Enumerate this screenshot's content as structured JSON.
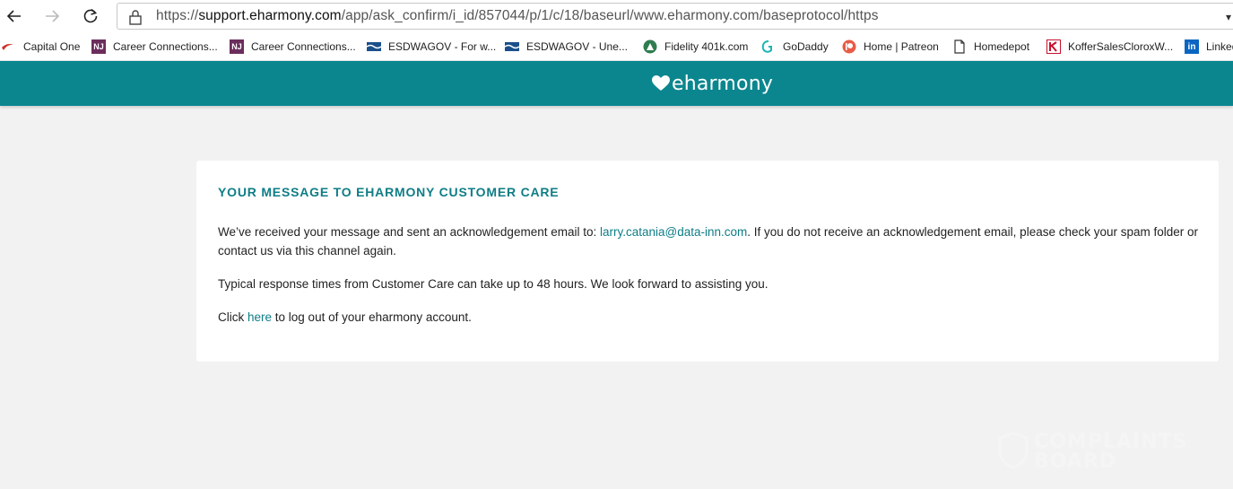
{
  "browser": {
    "url_scheme": "https://",
    "url_host": "support.eharmony.com",
    "url_path": "/app/ask_confirm/i_id/857044/p/1/c/18/baseurl/www.eharmony.com/baseprotocol/https"
  },
  "bookmarks": [
    {
      "label": "Capital One",
      "icon": "capital-one-swoosh",
      "color": "#d03027"
    },
    {
      "label": "Career Connections...",
      "icon": "nj-badge",
      "color": "#6b2d5c"
    },
    {
      "label": "Career Connections...",
      "icon": "nj-badge",
      "color": "#6b2d5c"
    },
    {
      "label": "ESDWAGOV - For w...",
      "icon": "esd-flag",
      "color": "#1a4f8a"
    },
    {
      "label": "ESDWAGOV - Une...",
      "icon": "esd-flag",
      "color": "#1a4f8a"
    },
    {
      "label": "Fidelity 401k.com",
      "icon": "fidelity-pyramid",
      "color": "#2e7d4f"
    },
    {
      "label": "GoDaddy",
      "icon": "godaddy-logo",
      "color": "#1bdbdb"
    },
    {
      "label": "Home | Patreon",
      "icon": "patreon-logo",
      "color": "#e85b46"
    },
    {
      "label": "Homedepot",
      "icon": "page-icon",
      "color": "#333333"
    },
    {
      "label": "KofferSalesCloroxW...",
      "icon": "koffer-k",
      "color": "#c8102e"
    },
    {
      "label": "Linked",
      "icon": "linkedin-logo",
      "color": "#0a66c2"
    }
  ],
  "header": {
    "logo_text": "eharmony",
    "brand_color": "#0b868f"
  },
  "card": {
    "title": "YOUR MESSAGE TO EHARMONY CUSTOMER CARE",
    "p1_before": "We’ve received your message and sent an acknowledgement email to: ",
    "p1_email": "larry.catania@data-inn.com",
    "p1_after": ". If you do not receive an acknowledgement email, please check your spam folder or contact us via this channel again.",
    "p2": "Typical response times from Customer Care can take up to 48 hours. We look forward to assisting you.",
    "p3_before": "Click ",
    "p3_link": "here",
    "p3_after": " to log out of your eharmony account."
  },
  "watermark": {
    "line1": "COMPLAINTS",
    "line2": "BOARD"
  }
}
